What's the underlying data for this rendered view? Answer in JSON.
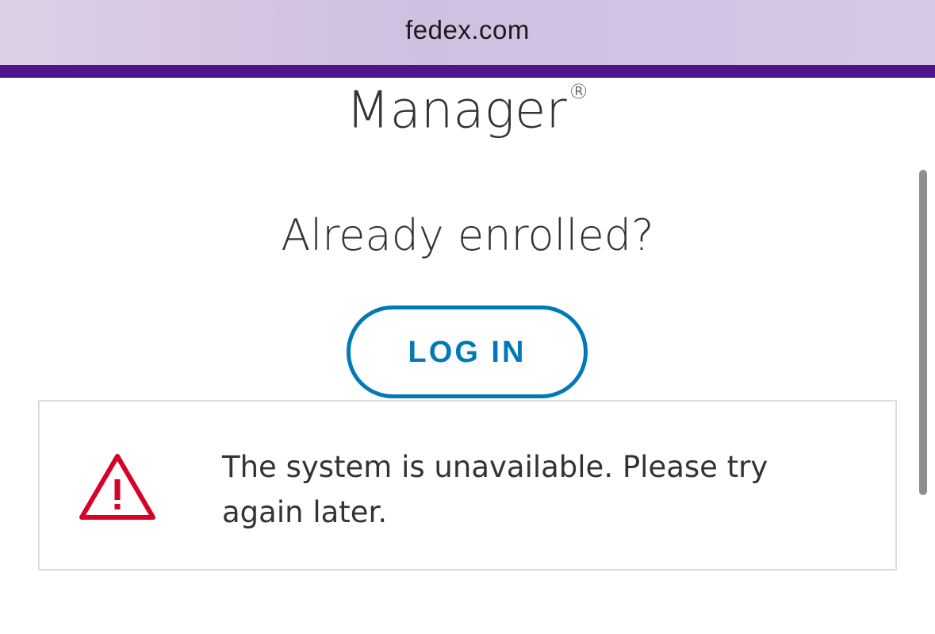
{
  "browser": {
    "url": "fedex.com",
    "accent_color": "#4d148c"
  },
  "main": {
    "title": "Manager",
    "title_mark": "®",
    "prompt": "Already enrolled?",
    "login_button_label": "LOG IN",
    "button_color": "#007ab7"
  },
  "alert": {
    "icon": "warning-triangle-icon",
    "icon_color": "#d6002a",
    "message": "The system is unavailable. Please try again later."
  }
}
